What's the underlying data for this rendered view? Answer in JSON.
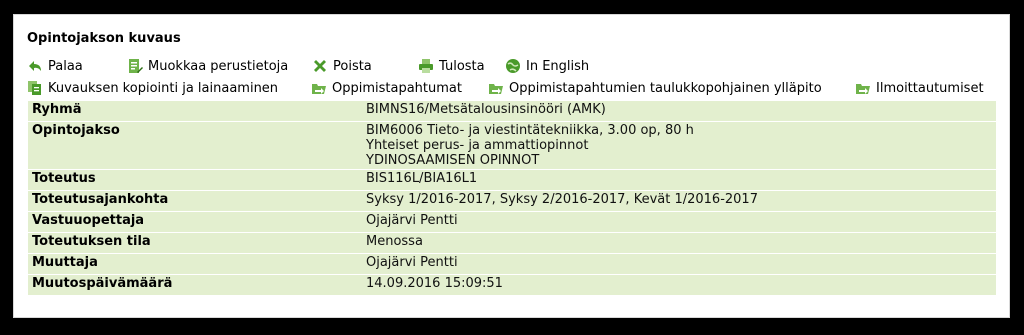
{
  "title": "Opintojakson kuvaus",
  "actions_row1": [
    {
      "label": "Palaa",
      "icon": "back-arrow-icon"
    },
    {
      "label": "Muokkaa perustietoja",
      "icon": "edit-document-icon"
    },
    {
      "label": "Poista",
      "icon": "delete-x-icon"
    },
    {
      "label": "Tulosta",
      "icon": "printer-icon"
    },
    {
      "label": "In English",
      "icon": "globe-icon"
    }
  ],
  "actions_row2": [
    {
      "label": "Kuvauksen kopiointi ja lainaaminen",
      "icon": "copy-document-icon"
    },
    {
      "label": "Oppimistapahtumat",
      "icon": "folder-arrow-icon"
    },
    {
      "label": "Oppimistapahtumien taulukkopohjainen ylläpito",
      "icon": "folder-arrow-icon"
    },
    {
      "label": "Ilmoittautumiset",
      "icon": "folder-arrow-icon"
    }
  ],
  "rows": [
    {
      "label": "Ryhmä",
      "value": [
        "BIMNS16/Metsätalousinsinööri (AMK)"
      ]
    },
    {
      "label": "Opintojakso",
      "value": [
        "BIM6006 Tieto- ja viestintätekniikka, 3.00 op, 80 h",
        "Yhteiset perus- ja ammattiopinnot",
        "YDINOSAAMISEN OPINNOT"
      ]
    },
    {
      "label": "Toteutus",
      "value": [
        "BIS116L/BIA16L1"
      ]
    },
    {
      "label": "Toteutusajankohta",
      "value": [
        "Syksy 1/2016-2017, Syksy 2/2016-2017, Kevät 1/2016-2017"
      ]
    },
    {
      "label": "Vastuuopettaja",
      "value": [
        "Ojajärvi Pentti"
      ]
    },
    {
      "label": "Toteutuksen tila",
      "value": [
        "Menossa"
      ]
    },
    {
      "label": "Muuttaja",
      "value": [
        "Ojajärvi Pentti"
      ]
    },
    {
      "label": "Muutospäivämäärä",
      "value": [
        "14.09.2016 15:09:51"
      ]
    }
  ],
  "colors": {
    "row_background": "#e3efcf",
    "icon_green": "#4a9a2a"
  }
}
